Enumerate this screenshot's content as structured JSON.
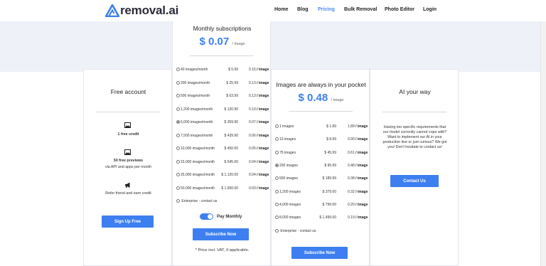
{
  "header": {
    "logo_text": "removal.ai",
    "nav": [
      "Home",
      "Blog",
      "Pricing",
      "Bulk Removal",
      "Photo Editor",
      "Login"
    ],
    "active_nav": "Pricing",
    "accent_color": "#3d7ff0"
  },
  "free": {
    "title": "Free account",
    "feature1": "1 free credit",
    "feature2_bold": "50 free previews",
    "feature2_rest": "via API and apps per month",
    "feature3": "Refer friend and earn credit",
    "button": "Sign Up Free",
    "icons": [
      "image-icon",
      "image-icon",
      "megaphone-icon"
    ]
  },
  "monthly": {
    "title": "Monthly subscriptions",
    "price": "$ 0.07",
    "unit": "/ image",
    "plans": [
      {
        "label": "40 images/month",
        "price": "$ 5.99",
        "per": "0.15"
      },
      {
        "label": "200 images/month",
        "price": "$ 25.99",
        "per": "0.13"
      },
      {
        "label": "500 images/month",
        "price": "$ 63.99",
        "per": "0.13"
      },
      {
        "label": "1,200 images/month",
        "price": "$ 120.90",
        "per": "0.10"
      },
      {
        "label": "5,000 images/month",
        "price": "$ 359.90",
        "per": "0.07"
      },
      {
        "label": "7,500 images/month",
        "price": "$ 439.90",
        "per": "0.06"
      },
      {
        "label": "10,000 images/month",
        "price": "$ 450.00",
        "per": "0.05"
      },
      {
        "label": "15,000 images/month",
        "price": "$ 645.00",
        "per": "0.04"
      },
      {
        "label": "25,000 images/month",
        "price": "$ 1,120.00",
        "per": "0.04"
      },
      {
        "label": "50,000 images/month",
        "price": "$ 1,650.00",
        "per": "0.03"
      }
    ],
    "per_suffix": "/ image",
    "selected_index": 4,
    "enterprise": "Enterprise - contact us",
    "toggle_label": "Pay Monthly",
    "toggle_on": true,
    "button": "Subscribe Now",
    "note": "* Price incl. VAT, if applicable."
  },
  "pocket": {
    "title": "Images are always in your pocket",
    "price": "$ 0.48",
    "unit": "/ image",
    "plans": [
      {
        "label": "1 images",
        "price": "$ 1.89",
        "per": "1.89"
      },
      {
        "label": "10 images",
        "price": "$ 8.99",
        "per": "0.90"
      },
      {
        "label": "75 images",
        "price": "$ 45.99",
        "per": "0.61"
      },
      {
        "label": "200 images",
        "price": "$ 95.99",
        "per": "0.48"
      },
      {
        "label": "500 images",
        "price": "$ 189.99",
        "per": "0.38"
      },
      {
        "label": "1,200 images",
        "price": "$ 379.00",
        "per": "0.32"
      },
      {
        "label": "4,000 images",
        "price": "$ 799.00",
        "per": "0.20"
      },
      {
        "label": "8,000 images",
        "price": "$ 1,499.00",
        "per": "0.19"
      }
    ],
    "per_suffix": "/ image",
    "selected_index": 3,
    "enterprise": "Enterprise - contact us",
    "button": "Subscribe Now"
  },
  "ai": {
    "title": "AI your way",
    "text_lines": [
      "Having too specific requirements that",
      "our model currently cannot cope with?",
      "Want to implement our AI in your",
      "production line or just curious? We got",
      "you! Don't hesitate to contact us!"
    ],
    "button": "Contact Us"
  }
}
